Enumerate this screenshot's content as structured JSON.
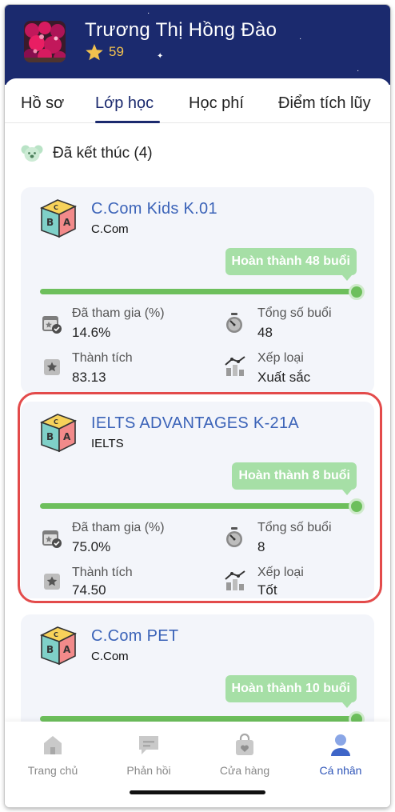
{
  "user": {
    "name": "Trương Thị Hồng Đào",
    "points": "59"
  },
  "tabs": [
    {
      "label": "Hồ sơ",
      "active": false
    },
    {
      "label": "Lớp học",
      "active": true
    },
    {
      "label": "Học phí",
      "active": false
    },
    {
      "label": "Điểm tích lũy",
      "active": false
    }
  ],
  "section": {
    "title": "Đã kết thúc (4)"
  },
  "stat_labels": {
    "attended": "Đã tham gia (%)",
    "total": "Tổng số buổi",
    "score": "Thành tích",
    "rank": "Xếp loại"
  },
  "courses": [
    {
      "title": "C.Com Kids K.01",
      "org": "C.Com",
      "badge": "Hoàn thành 48 buổi",
      "progress": 1.0,
      "attended": "14.6%",
      "total_sessions": "48",
      "score": "83.13",
      "rank": "Xuất sắc"
    },
    {
      "title": "IELTS ADVANTAGES K-21A",
      "org": "IELTS",
      "badge": "Hoàn thành 8 buổi",
      "progress": 1.0,
      "attended": "75.0%",
      "total_sessions": "8",
      "score": "74.50",
      "rank": "Tốt",
      "highlighted": true
    },
    {
      "title": "C.Com PET",
      "org": "C.Com",
      "badge": "Hoàn thành 10 buổi",
      "progress": 1.0
    }
  ],
  "bottom_nav": [
    {
      "label": "Trang chủ",
      "icon": "home-icon",
      "active": false
    },
    {
      "label": "Phản hồi",
      "icon": "chat-icon",
      "active": false
    },
    {
      "label": "Cửa hàng",
      "icon": "shop-bag-icon",
      "active": false
    },
    {
      "label": "Cá nhân",
      "icon": "person-icon",
      "active": true
    }
  ],
  "colors": {
    "header_bg": "#1b2a6e",
    "accent_blue": "#3b63b8",
    "progress_green": "#6dbf5c",
    "badge_green": "#a6dfa6",
    "highlight_red": "#e34b4b",
    "star_gold": "#f2c14e"
  }
}
